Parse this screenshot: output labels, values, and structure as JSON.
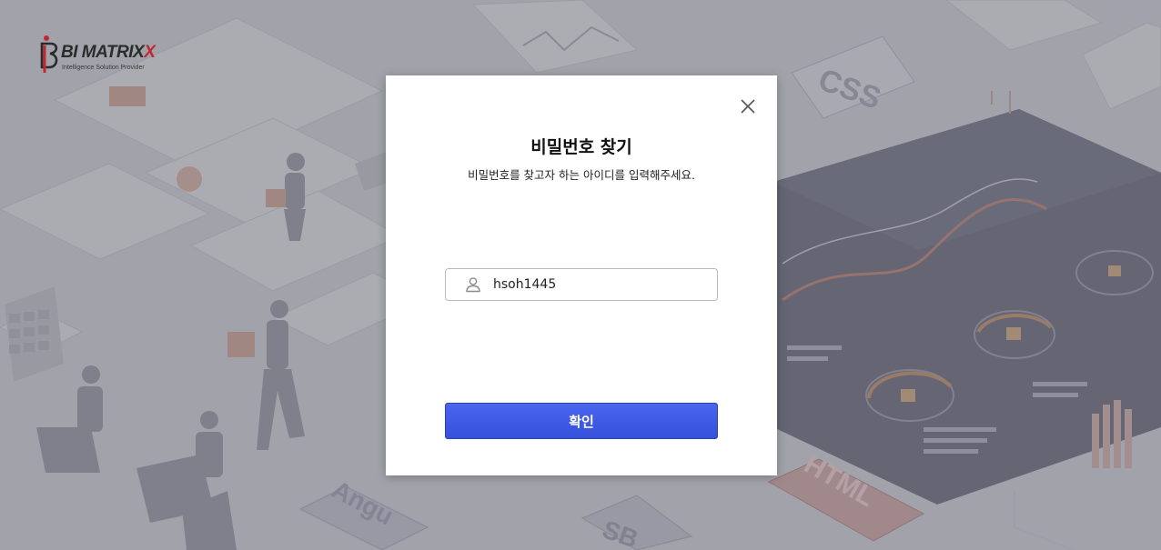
{
  "brand": {
    "name_main": "BI MATRIX",
    "name_x": "X",
    "tagline": "Intelligence Solution Provider"
  },
  "background": {
    "labels": [
      "CSS",
      "HTML",
      "Angu",
      "SB"
    ]
  },
  "dialog": {
    "title": "비밀번호 찾기",
    "subtitle": "비밀번호를 찾고자 하는 아이디를 입력해주세요.",
    "id_input_value": "hsoh1445",
    "confirm_label": "확인"
  },
  "colors": {
    "accent": "#3a56e4",
    "logo_red": "#c0282d"
  },
  "icons": [
    "close-icon",
    "user-icon",
    "logo-mark-icon"
  ]
}
